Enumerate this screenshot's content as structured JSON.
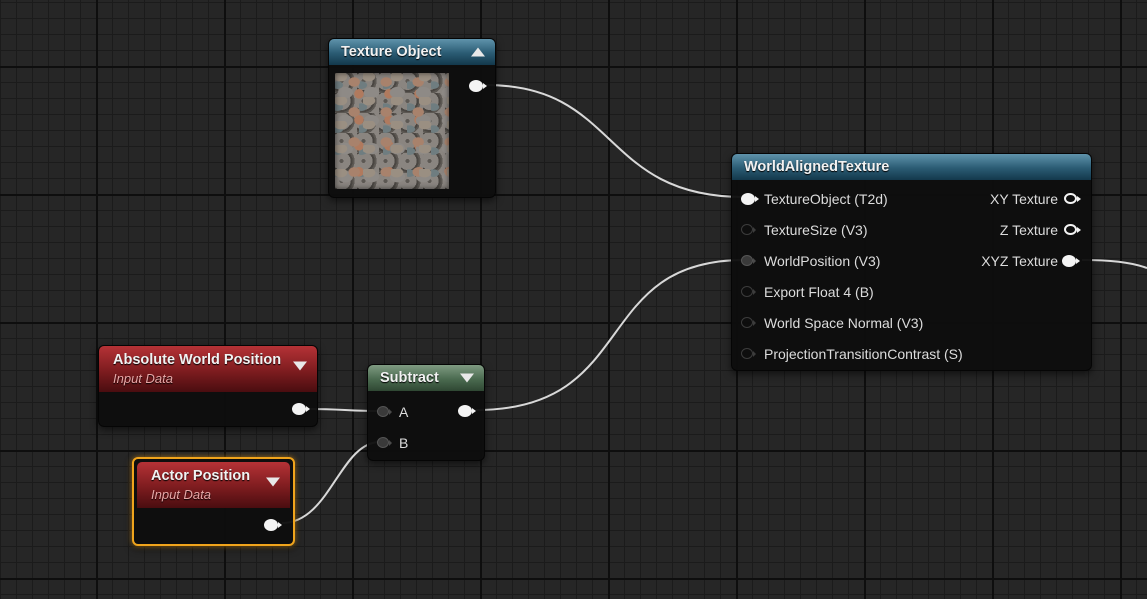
{
  "nodes": {
    "texture_object": {
      "title": "Texture Object"
    },
    "world_aligned_texture": {
      "title": "WorldAlignedTexture",
      "inputs": [
        "TextureObject (T2d)",
        "TextureSize (V3)",
        "WorldPosition (V3)",
        "Export Float 4 (B)",
        "World Space Normal (V3)",
        "ProjectionTransitionContrast (S)"
      ],
      "outputs": [
        "XY Texture",
        "Z Texture",
        "XYZ Texture"
      ]
    },
    "absolute_world_position": {
      "title": "Absolute World Position",
      "subtitle": "Input Data"
    },
    "subtract": {
      "title": "Subtract",
      "inputs": [
        "A",
        "B"
      ]
    },
    "actor_position": {
      "title": "Actor Position",
      "subtitle": "Input Data"
    }
  },
  "colors": {
    "wire": "#d8d8d8",
    "selection": "#f0a41c",
    "texture_header": "#2a5b73",
    "math_header": "#4a6a4f",
    "input_header": "#7d1c1f"
  }
}
